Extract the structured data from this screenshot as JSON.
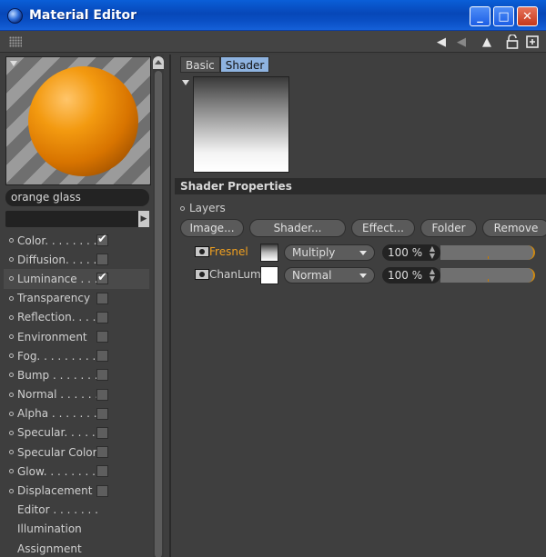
{
  "window": {
    "title": "Material Editor",
    "controls": {
      "minimize": "_",
      "maximize": "□",
      "close": "✕"
    }
  },
  "toolbar": {
    "icons": [
      "grip-icon",
      "back-arrow-icon",
      "forward-arrow-icon",
      "up-arrow-icon",
      "lock-icon",
      "new-window-icon"
    ]
  },
  "material": {
    "name": "orange glass",
    "preview_colors": {
      "sphere": "#f39a10",
      "stripes_light": "#9b9b9b",
      "stripes_dark": "#6f6f6f"
    }
  },
  "channels": [
    {
      "label": "Color. . . . . . . .",
      "has_checkbox": true,
      "checked": true,
      "active": false
    },
    {
      "label": "Diffusion. . . . . .",
      "has_checkbox": true,
      "checked": false,
      "active": false
    },
    {
      "label": "Luminance . . .",
      "has_checkbox": true,
      "checked": true,
      "active": true
    },
    {
      "label": "Transparency",
      "has_checkbox": true,
      "checked": false,
      "active": false
    },
    {
      "label": "Reflection. . . .",
      "has_checkbox": true,
      "checked": false,
      "active": false
    },
    {
      "label": "Environment",
      "has_checkbox": true,
      "checked": false,
      "active": false
    },
    {
      "label": "Fog. . . . . . . . .",
      "has_checkbox": true,
      "checked": false,
      "active": false
    },
    {
      "label": "Bump . . . . . . .",
      "has_checkbox": true,
      "checked": false,
      "active": false
    },
    {
      "label": "Normal . . . . . . .",
      "has_checkbox": true,
      "checked": false,
      "active": false
    },
    {
      "label": "Alpha . . . . . . .",
      "has_checkbox": true,
      "checked": false,
      "active": false
    },
    {
      "label": "Specular. . . . .",
      "has_checkbox": true,
      "checked": false,
      "active": false
    },
    {
      "label": "Specular Color",
      "has_checkbox": true,
      "checked": false,
      "active": false
    },
    {
      "label": "Glow. . . . . . . .",
      "has_checkbox": true,
      "checked": false,
      "active": false
    },
    {
      "label": "Displacement",
      "has_checkbox": true,
      "checked": false,
      "active": false
    },
    {
      "label": "Editor . . . . . . .",
      "has_checkbox": false,
      "checked": false,
      "active": false
    },
    {
      "label": "Illumination",
      "has_checkbox": false,
      "checked": false,
      "active": false
    },
    {
      "label": "Assignment",
      "has_checkbox": false,
      "checked": false,
      "active": false
    }
  ],
  "tabs": [
    {
      "label": "Basic",
      "active": false
    },
    {
      "label": "Shader",
      "active": true
    }
  ],
  "shader_properties": {
    "title": "Shader Properties",
    "layers_label": "Layers",
    "buttons": [
      "Image...",
      "Shader...",
      "Effect...",
      "Folder",
      "Remove"
    ],
    "layers": [
      {
        "name": "Fresnel",
        "name_color": "#f0a020",
        "swatch": "#ffffff",
        "swatch_gradient": true,
        "mode": "Multiply",
        "opacity": "100 %",
        "opacity_fraction": 1.0
      },
      {
        "name": "ChanLum",
        "name_color": "#d0d0d0",
        "swatch": "#ffffff",
        "swatch_gradient": false,
        "mode": "Normal",
        "opacity": "100 %",
        "opacity_fraction": 1.0
      }
    ]
  }
}
